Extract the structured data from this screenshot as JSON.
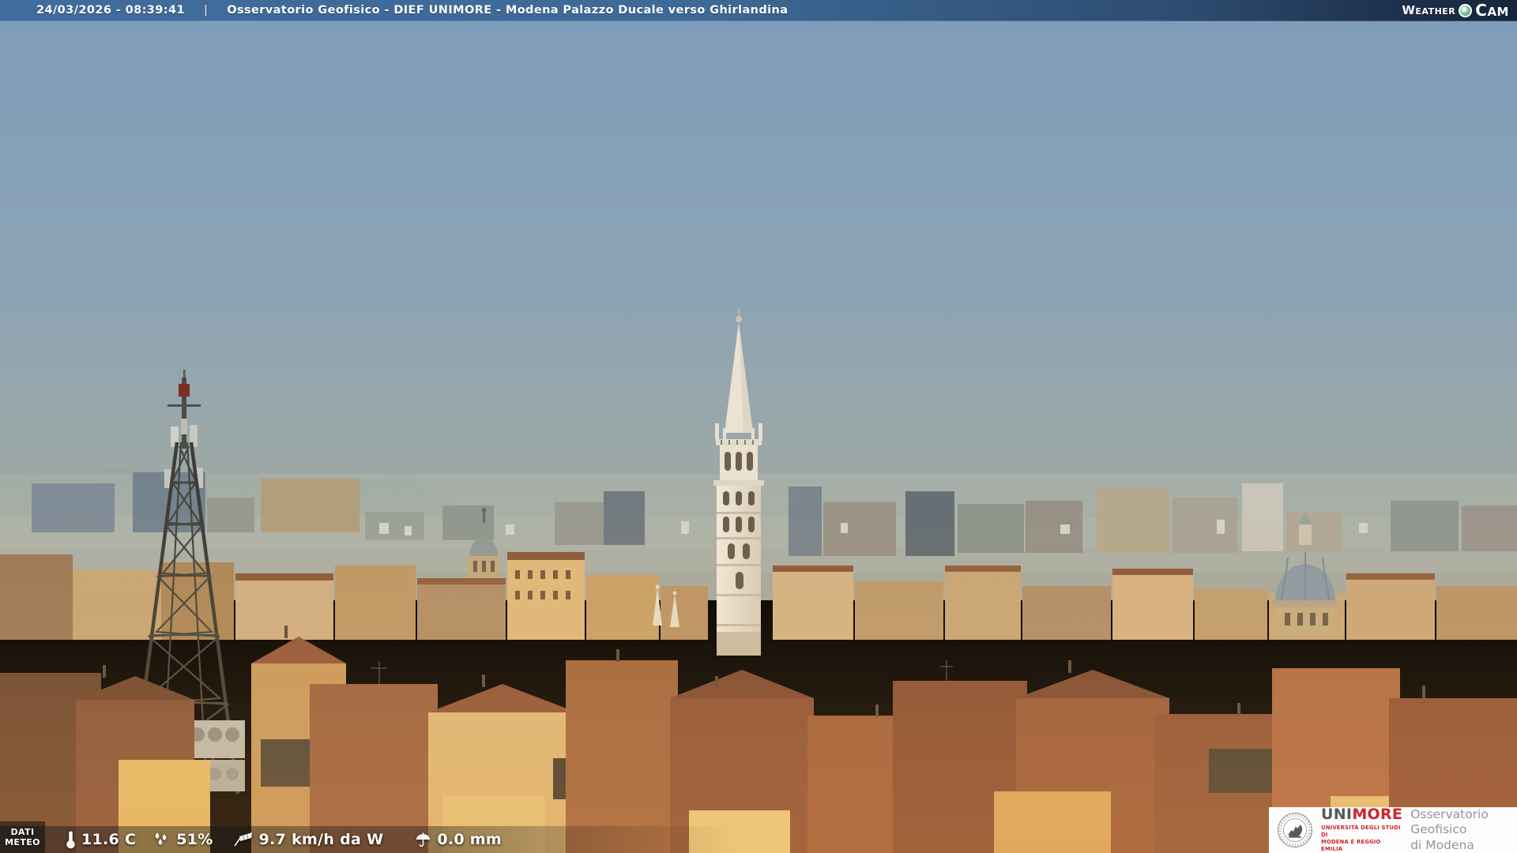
{
  "header": {
    "datetime": "24/03/2026 - 08:39:41",
    "separator": "|",
    "title": "Osservatorio Geofisico - DIEF UNIMORE - Modena Palazzo Ducale verso Ghirlandina",
    "brand": {
      "weather_label": "Weather",
      "cam_label": "Cam",
      "globe_icon": "globe-icon"
    }
  },
  "weather_bar": {
    "label_line1": "DATI",
    "label_line2": "METEO",
    "items": [
      {
        "icon": "thermometer-icon",
        "value": "11.6 C"
      },
      {
        "icon": "humidity-icon",
        "value": "51%"
      },
      {
        "icon": "wind-icon",
        "value": "9.7 km/h da W"
      },
      {
        "icon": "rain-icon",
        "value": "0.0 mm"
      }
    ]
  },
  "logo_box": {
    "brand_uni": "UNI",
    "brand_more": "MORE",
    "subtitle_line1": "UNIVERSITÀ DEGLI STUDI DI",
    "subtitle_line2": "MODENA E REGGIO EMILIA",
    "right_line1": "Osservatorio Geofisico",
    "right_line2": "di Modena"
  },
  "colors": {
    "topbar_left": "#406c9c",
    "topbar_right": "#16263c",
    "unimore_red": "#d2232a",
    "unimore_gray": "#56575b",
    "observatory_text": "#939598",
    "sky_top": "#7e9cba",
    "sky_horizon": "#a6ab9f"
  }
}
